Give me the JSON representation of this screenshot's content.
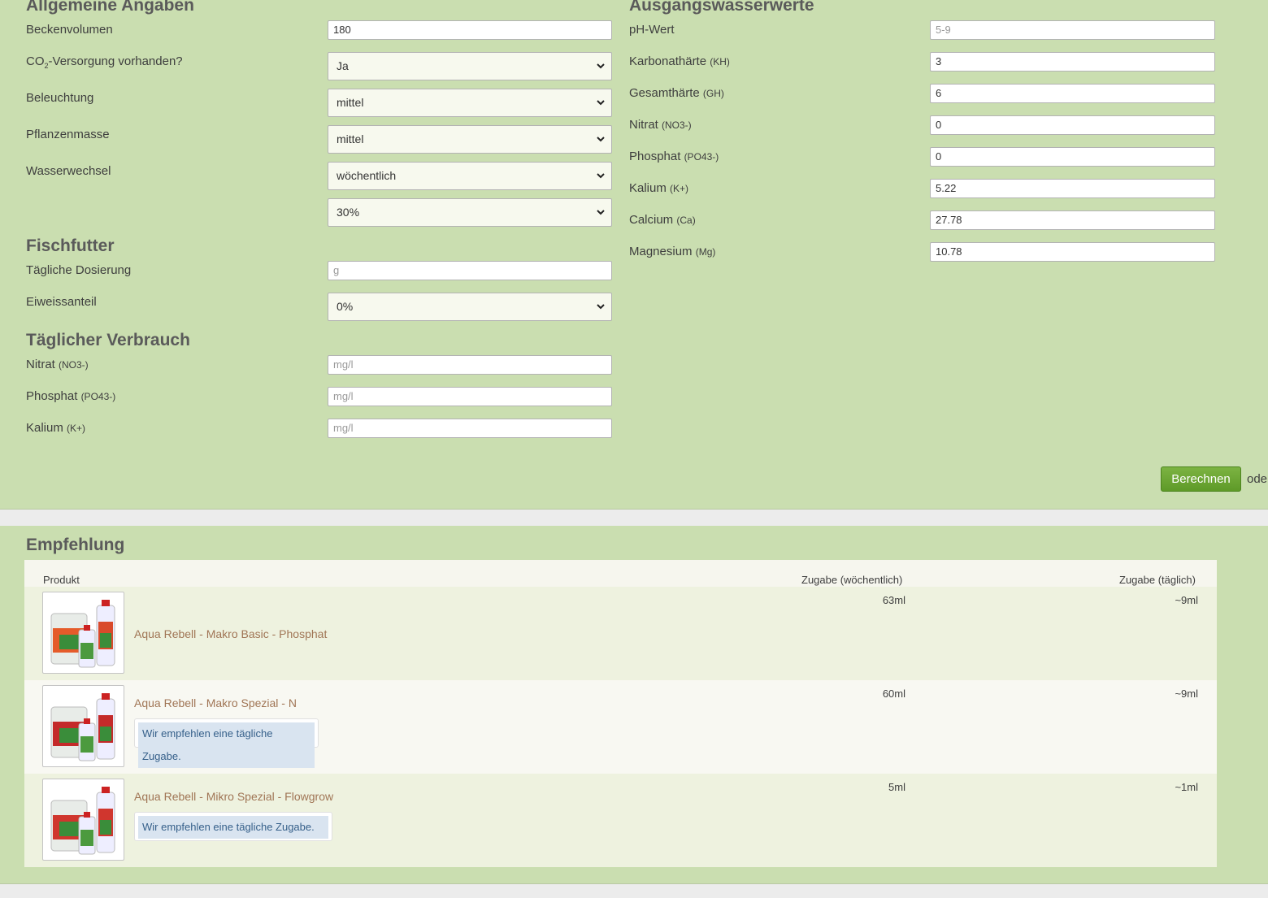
{
  "general": {
    "title": "Allgemeine Angaben",
    "beckenvolumen_label": "Beckenvolumen",
    "beckenvolumen_value": "180",
    "co2_label_pre": "CO",
    "co2_label_sub": "2",
    "co2_label_post": "-Versorgung vorhanden?",
    "co2_value": "Ja",
    "beleuchtung_label": "Beleuchtung",
    "beleuchtung_value": "mittel",
    "pflanzenmasse_label": "Pflanzenmasse",
    "pflanzenmasse_value": "mittel",
    "wasserwechsel_label": "Wasserwechsel",
    "wasserwechsel_value": "wöchentlich",
    "wasserwechsel_percent": "30%"
  },
  "fischfutter": {
    "title": "Fischfutter",
    "dosierung_label": "Tägliche Dosierung",
    "dosierung_placeholder": "g",
    "eiweiss_label": "Eiweissanteil",
    "eiweiss_value": "0%"
  },
  "verbrauch": {
    "title": "Täglicher Verbrauch",
    "nitrat_label": "Nitrat",
    "nitrat_unit": "(NO3-)",
    "phosphat_label": "Phosphat",
    "phosphat_unit": "(PO43-)",
    "kalium_label": "Kalium",
    "kalium_unit": "(K+)",
    "placeholder": "mg/l"
  },
  "ausgang": {
    "title": "Ausgangswasserwerte",
    "ph_label": "pH-Wert",
    "ph_placeholder": "5-9",
    "kh_label": "Karbonathärte",
    "kh_unit": "(KH)",
    "kh_value": "3",
    "gh_label": "Gesamthärte",
    "gh_unit": "(GH)",
    "gh_value": "6",
    "nitrat_label": "Nitrat",
    "nitrat_unit": "(NO3-)",
    "nitrat_value": "0",
    "phosphat_label": "Phosphat",
    "phosphat_unit": "(PO43-)",
    "phosphat_value": "0",
    "kalium_label": "Kalium",
    "kalium_unit": "(K+)",
    "kalium_value": "5.22",
    "calcium_label": "Calcium",
    "calcium_unit": "(Ca)",
    "calcium_value": "27.78",
    "magnesium_label": "Magnesium",
    "magnesium_unit": "(Mg)",
    "magnesium_value": "10.78"
  },
  "actions": {
    "berechnen": "Berechnen",
    "oder": "oder"
  },
  "empfehlung": {
    "title": "Empfehlung",
    "col_produkt": "Produkt",
    "col_weekly": "Zugabe (wöchentlich)",
    "col_daily": "Zugabe (täglich)",
    "rows": [
      {
        "name": "Aqua Rebell - Makro Basic - Phosphat",
        "weekly": "63ml",
        "daily": "~9ml",
        "hint": ""
      },
      {
        "name": "Aqua Rebell - Makro Spezial - N",
        "weekly": "60ml",
        "daily": "~9ml",
        "hint": "Wir empfehlen eine tägliche Zugabe."
      },
      {
        "name": "Aqua Rebell - Mikro Spezial - Flowgrow",
        "weekly": "5ml",
        "daily": "~1ml",
        "hint": "Wir empfehlen eine tägliche Zugabe."
      }
    ]
  },
  "colors": {
    "panel": "#cadeb0",
    "button": "#6aa532",
    "product_link": "#a07555",
    "hint_bg": "#d9e4f0"
  }
}
